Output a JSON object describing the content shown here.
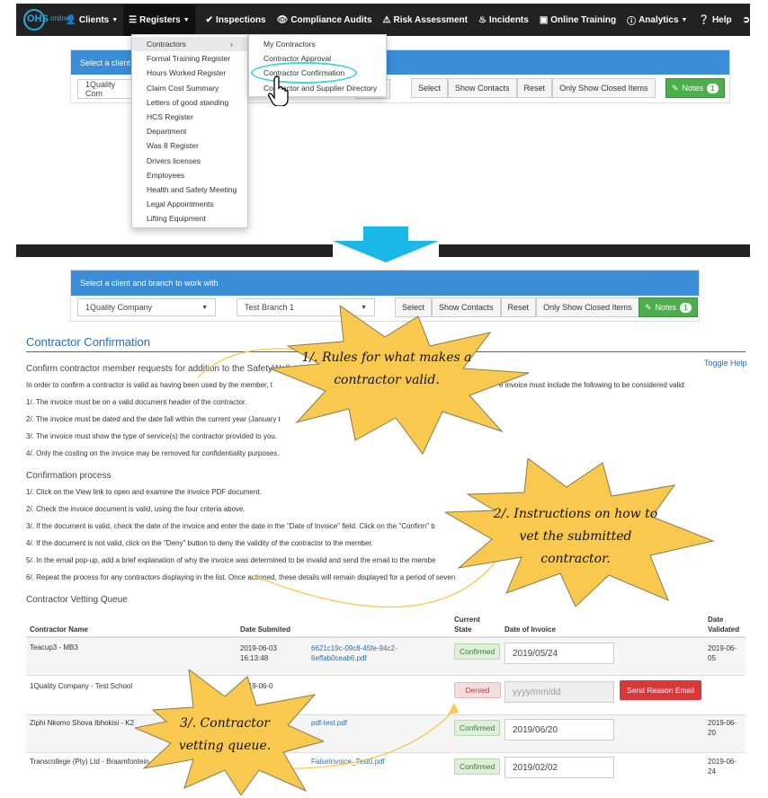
{
  "nav": {
    "logo": "OHS",
    "logo_sub": "online",
    "items": [
      "Clients",
      "Registers",
      "Inspections",
      "Compliance Audits",
      "Risk Assessment",
      "Incidents",
      "Online Training",
      "Analytics",
      "Help"
    ]
  },
  "top_panel": {
    "header": "Select a client",
    "client_value": "1Quality Com",
    "buttons": [
      "Select",
      "Show Contacts",
      "Reset",
      "Only Show Closed Items"
    ],
    "notes_label": "Notes",
    "notes_count": "1"
  },
  "registers_menu": [
    "Contractors",
    "Formal Training Register",
    "Hours Worked Register",
    "Claim Cost Summary",
    "Letters of good standing",
    "HCS Register",
    "Department",
    "Was 8 Register",
    "Drivers licenses",
    "Employees",
    "Health and Safety Meeting",
    "Legal Appointments",
    "Lifting Equipment"
  ],
  "contractors_submenu": [
    "My Contractors",
    "Contractor Approval",
    "Contractor Confirmation",
    "Contractor and Supplier Directory"
  ],
  "panel2": {
    "header": "Select a client and branch to work with",
    "client": "1Quality Company",
    "branch": "Test Branch 1",
    "buttons": [
      "Select",
      "Show Contacts",
      "Reset",
      "Only Show Closed Items"
    ],
    "notes_label": "Notes",
    "notes_count": "1"
  },
  "page": {
    "title": "Contractor Confirmation",
    "toggle_help": "Toggle Help",
    "subtitle": "Confirm contractor member requests for addition to the SafetyWallet Memb",
    "intro": "In order to confirm a contractor is valid as having been used by the member, t",
    "intro_tail": "e invoice must include the following to be considered valid:",
    "rules": [
      "1/. The invoice must be on a valid document header of the contractor.",
      "2/. The invoice must be dated and the date fall within the current year (January t",
      "3/. The invoice must show the type of service(s) the contractor provided to you.",
      "4/. Only the costing on the invoice may be removed for confidentiality purposes."
    ],
    "process_title": "Confirmation process",
    "process": [
      "1/. Click on the View link to open and examine the invoice PDF document.",
      "2/. Check the invoice document is valid, using the four criteria above.",
      "3/. If the document is valid, check the date of the invoice and enter the date in the \"Date of Invoice\" field. Click on the \"Confirm\" b",
      "4/. If the document is not valid, click on the \"Deny\" button to deny the validity of the contractor to the member.",
      "5/. In the email pop-up, add a brief explanation of why the invoice was determined to be invalid and send the email to the membe",
      "6/. Repeat the process for any contractors displaying in the list. Once actioned, these details will remain displayed for a period of seven"
    ],
    "queue_title": "Contractor Vetting Queue"
  },
  "table": {
    "headers": {
      "name": "Contractor Name",
      "date": "Date Submited",
      "state": "Current State",
      "invoice": "Date of Invoice",
      "validated": "Date Validated"
    },
    "rows": [
      {
        "name": "Teacup3 - MB3",
        "date": "2019-06-03 16:13:48",
        "file": "6621c19c-09c8-45fe-94c2-6effab0ceab6.pdf",
        "state": "Confirmed",
        "invoice": "2019/05/24",
        "validated": "2019-06-05"
      },
      {
        "name": "1Quality Company - Test School",
        "date": "2019-06-0",
        "file": "",
        "state": "Denied",
        "invoice": "yyyy/mm/dd",
        "validated": "",
        "action": "Send Reason Email"
      },
      {
        "name": "Ziphi Nkomo Shova Ibhokisi - K2",
        "date": "",
        "file": "pdf-test.pdf",
        "state": "Confirmed",
        "invoice": "2019/06/20",
        "validated": "2019-06-20"
      },
      {
        "name": "Transcollege (Pty) Ltd - Braamfontein",
        "date": "8",
        "file": "FalseInvoice_Test0.pdf",
        "state": "Confirmed",
        "invoice": "2019/02/02",
        "validated": "2019-06-24"
      }
    ]
  },
  "callouts": [
    "1/. Rules for what makes a contractor valid.",
    "2/. Instructions on how to vet the submitted contractor.",
    "3/. Contractor vetting queue."
  ],
  "colors": {
    "navbar": "#222222",
    "panel_header": "#3c8dd8",
    "callout": "#f8c94e",
    "arrow": "#1ab8e6",
    "highlight_ring": "#3fd6d8"
  }
}
